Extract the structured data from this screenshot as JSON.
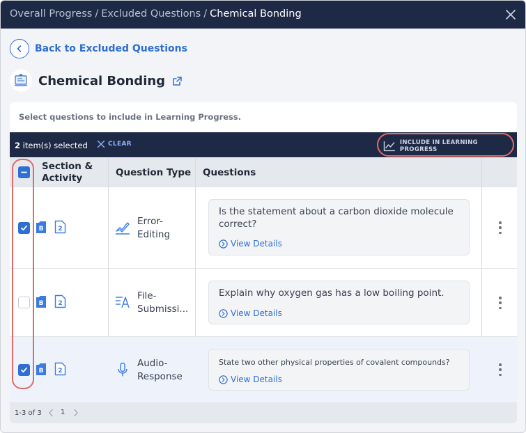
{
  "breadcrumb": {
    "items": [
      "Overall Progress",
      "Excluded Questions"
    ],
    "separator": "/",
    "current": "Chemical Bonding"
  },
  "back": {
    "label": "Back to Excluded Questions"
  },
  "title": {
    "text": "Chemical Bonding"
  },
  "hint": "Select questions to include in Learning Progress.",
  "selection": {
    "count": "2",
    "suffix": " item(s) selected",
    "clear_label": "CLEAR",
    "include_label": "INCLUDE IN LEARNING PROGRESS"
  },
  "table": {
    "headers": {
      "section": "Section & Activity",
      "qtype": "Question Type",
      "questions": "Questions"
    },
    "rows": [
      {
        "checked": true,
        "section_badge": "B",
        "activity_badge": "2",
        "qtype_line1": "Error-",
        "qtype_line2": "Editing",
        "question": "Is the statement about a carbon dioxide molecule correct?",
        "view_label": "View Details"
      },
      {
        "checked": false,
        "section_badge": "B",
        "activity_badge": "2",
        "qtype_line1": "File-",
        "qtype_line2": "Submissi...",
        "question": "Explain why oxygen gas has a low boiling point.",
        "view_label": "View Details"
      },
      {
        "checked": true,
        "section_badge": "B",
        "activity_badge": "2",
        "qtype_line1": "Audio-",
        "qtype_line2": "Response",
        "question": "State two other physical properties of covalent compounds?",
        "view_label": "View Details"
      }
    ]
  },
  "pagination": {
    "range": "1-3 of 3",
    "page": "1"
  },
  "colors": {
    "navy": "#1e2a45",
    "accent": "#2f6fd1",
    "highlight": "#e06a6a"
  }
}
